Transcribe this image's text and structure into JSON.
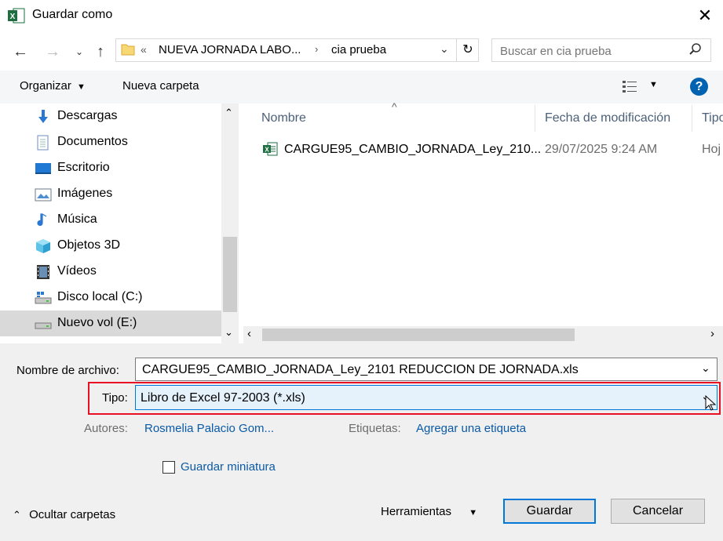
{
  "window": {
    "title": "Guardar como"
  },
  "address": {
    "overflow": "«",
    "segments": [
      "NUEVA JORNADA LABO...",
      "cia prueba"
    ]
  },
  "search": {
    "placeholder": "Buscar en cia prueba"
  },
  "toolbar": {
    "organize": "Organizar",
    "new_folder": "Nueva carpeta"
  },
  "nav": {
    "items": [
      {
        "label": "Descargas",
        "icon": "download-icon"
      },
      {
        "label": "Documentos",
        "icon": "documents-icon"
      },
      {
        "label": "Escritorio",
        "icon": "desktop-icon"
      },
      {
        "label": "Imágenes",
        "icon": "pictures-icon"
      },
      {
        "label": "Música",
        "icon": "music-icon"
      },
      {
        "label": "Objetos 3D",
        "icon": "objects3d-icon"
      },
      {
        "label": "Vídeos",
        "icon": "videos-icon"
      },
      {
        "label": "Disco local (C:)",
        "icon": "local-disk-icon"
      },
      {
        "label": "Nuevo vol (E:)",
        "icon": "drive-icon"
      }
    ]
  },
  "files": {
    "columns": [
      "Nombre",
      "Fecha de modificación",
      "Tipo"
    ],
    "rows": [
      {
        "name": "CARGUE95_CAMBIO_JORNADA_Ley_210...",
        "date": "29/07/2025 9:24 AM",
        "type": "Hoj"
      }
    ]
  },
  "form": {
    "filename_label": "Nombre de archivo:",
    "filename_value": "CARGUE95_CAMBIO_JORNADA_Ley_2101 REDUCCION DE JORNADA.xls",
    "type_label": "Tipo:",
    "type_value": "Libro de Excel 97-2003 (*.xls)",
    "authors_label": "Autores:",
    "authors_value": "Rosmelia Palacio Gom...",
    "tags_label": "Etiquetas:",
    "tags_value": "Agregar una etiqueta",
    "thumbnail_label": "Guardar miniatura"
  },
  "footer": {
    "hide_folders": "Ocultar carpetas",
    "tools": "Herramientas",
    "save": "Guardar",
    "cancel": "Cancelar"
  },
  "colors": {
    "highlight_border": "#e81123",
    "accent": "#0078d7",
    "link": "#0b5aa5"
  }
}
